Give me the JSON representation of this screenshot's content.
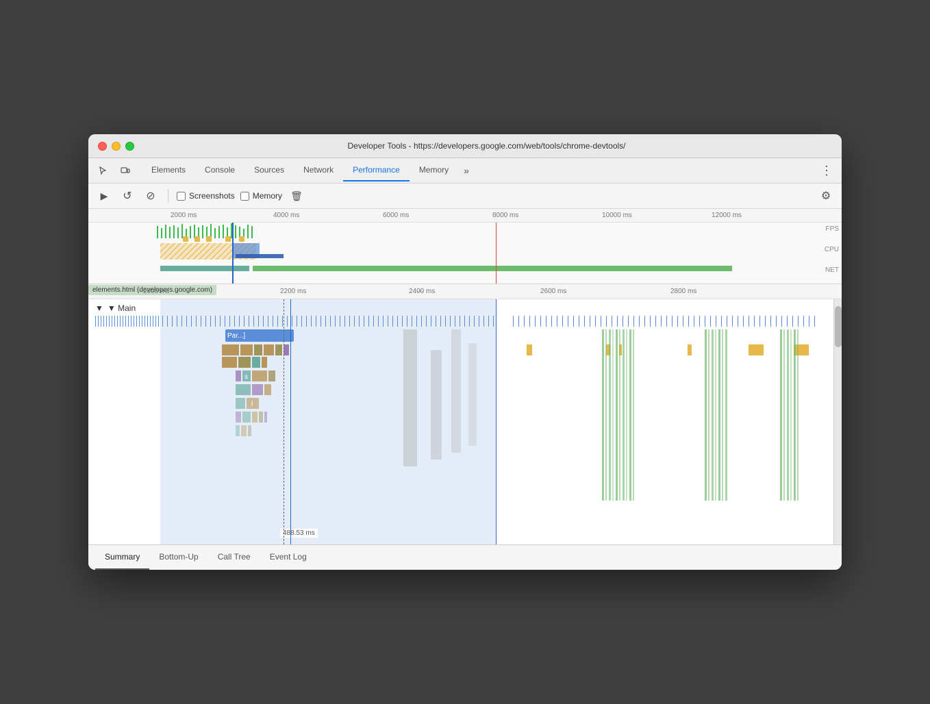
{
  "window": {
    "title": "Developer Tools - https://developers.google.com/web/tools/chrome-devtools/"
  },
  "tabs": {
    "items": [
      {
        "label": "Elements",
        "active": false
      },
      {
        "label": "Console",
        "active": false
      },
      {
        "label": "Sources",
        "active": false
      },
      {
        "label": "Network",
        "active": false
      },
      {
        "label": "Performance",
        "active": true
      },
      {
        "label": "Memory",
        "active": false
      }
    ],
    "more_label": "»",
    "menu_label": "⋮"
  },
  "toolbar": {
    "record_label": "▶",
    "reload_label": "↺",
    "clear_label": "⊘",
    "screenshots_label": "Screenshots",
    "memory_label": "Memory",
    "trash_label": "🗑",
    "gear_label": "⚙"
  },
  "overview": {
    "time_labels": [
      "2000 ms",
      "4000 ms",
      "6000 ms",
      "8000 ms",
      "10000 ms",
      "12000 ms"
    ],
    "track_labels": [
      "FPS",
      "CPU",
      "NET"
    ]
  },
  "timeline": {
    "time_labels": [
      "2000 ms",
      "2200 ms",
      "2400 ms",
      "2600 ms",
      "2800 ms"
    ],
    "section_label": "▼ Main",
    "timestamp": "488.53 ms",
    "url": "elements.html (developers.google.com)"
  },
  "bottom_tabs": {
    "items": [
      {
        "label": "Summary",
        "active": true
      },
      {
        "label": "Bottom-Up",
        "active": false
      },
      {
        "label": "Call Tree",
        "active": false
      },
      {
        "label": "Event Log",
        "active": false
      }
    ]
  },
  "colors": {
    "accent_blue": "#1a73e8",
    "selection_blue": "#b8cef0",
    "fps_green": "#3dba4e",
    "cpu_yellow": "#e8b84b",
    "net_blue": "#4a90d9",
    "flame_blue": "#5b8dd9",
    "flame_brown": "#b8955a",
    "flame_olive": "#a0945a",
    "flame_teal": "#6aada0",
    "flame_purple": "#9b7bb5",
    "flame_green": "#6db96d",
    "red_line": "#d94040"
  }
}
